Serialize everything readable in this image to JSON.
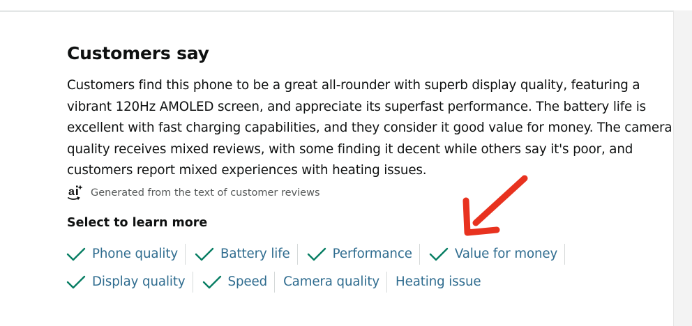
{
  "section": {
    "title": "Customers say",
    "summary": "Customers find this phone to be a great all-rounder with superb display quality, featuring a vibrant 120Hz AMOLED screen, and appreciate its superfast performance. The battery life is excellent with fast charging capabilities, and they consider it good value for money. The camera quality receives mixed reviews, with some finding it decent while others say it's poor, and customers report mixed experiences with heating issues.",
    "ai_note": "Generated from the text of customer reviews",
    "ai_logo": "ai",
    "learn_more_heading": "Select to learn more"
  },
  "aspects": {
    "row1": [
      {
        "label": "Phone quality",
        "icon": "checkmark-icon"
      },
      {
        "label": "Battery life",
        "icon": "checkmark-icon"
      },
      {
        "label": "Performance",
        "icon": "checkmark-icon"
      },
      {
        "label": "Value for money",
        "icon": "checkmark-icon"
      }
    ],
    "row2": [
      {
        "label": "Display quality",
        "icon": "checkmark-icon"
      },
      {
        "label": "Speed",
        "icon": "checkmark-icon"
      },
      {
        "label": "Camera quality",
        "icon": null
      },
      {
        "label": "Heating issue",
        "icon": null
      }
    ]
  },
  "colors": {
    "link": "#2f6c8f",
    "check": "#067d62",
    "annotation_arrow": "#e8321f"
  }
}
